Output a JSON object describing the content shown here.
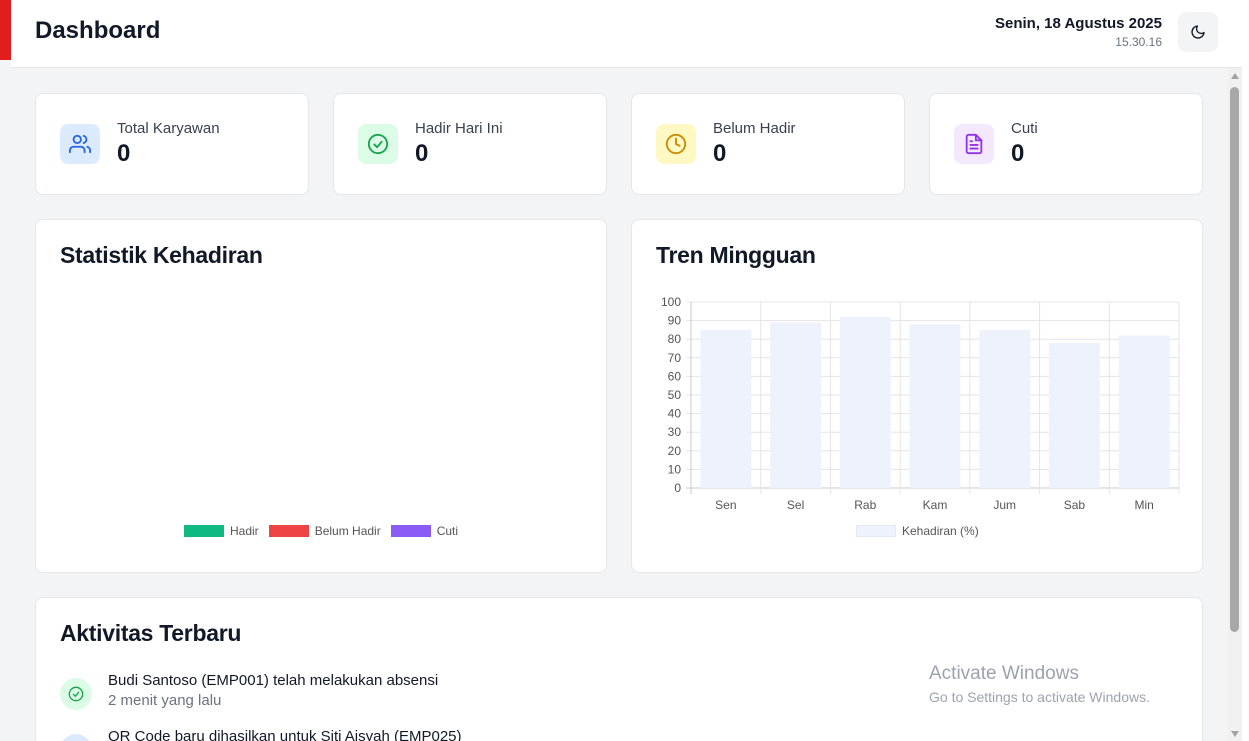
{
  "header": {
    "title": "Dashboard",
    "date": "Senin, 18 Agustus 2025",
    "time": "15.30.16",
    "theme_toggle_icon": "moon-icon"
  },
  "stats": [
    {
      "label": "Total Karyawan",
      "value": "0",
      "icon": "users-icon",
      "color": "#2563eb",
      "bg": "#dbeafe"
    },
    {
      "label": "Hadir Hari Ini",
      "value": "0",
      "icon": "check-circle-icon",
      "color": "#16a34a",
      "bg": "#dcfce7"
    },
    {
      "label": "Belum Hadir",
      "value": "0",
      "icon": "clock-icon",
      "color": "#ca8a04",
      "bg": "#fef9c3"
    },
    {
      "label": "Cuti",
      "value": "0",
      "icon": "document-icon",
      "color": "#9333ea",
      "bg": "#f3e8ff"
    }
  ],
  "attendance_panel": {
    "title": "Statistik Kehadiran",
    "legend": [
      {
        "label": "Hadir",
        "color": "#10b981"
      },
      {
        "label": "Belum Hadir",
        "color": "#ef4444"
      },
      {
        "label": "Cuti",
        "color": "#8b5cf6"
      }
    ]
  },
  "weekly_panel": {
    "title": "Tren Mingguan"
  },
  "chart_data": {
    "type": "bar",
    "title": "Tren Mingguan",
    "categories": [
      "Sen",
      "Sel",
      "Rab",
      "Kam",
      "Jum",
      "Sab",
      "Min"
    ],
    "series": [
      {
        "name": "Kehadiran (%)",
        "values": [
          85,
          89,
          92,
          88,
          85,
          78,
          82
        ],
        "color": "#eef2fd"
      }
    ],
    "y_ticks": [
      0,
      10,
      20,
      30,
      40,
      50,
      60,
      70,
      80,
      90,
      100
    ],
    "ylim": [
      0,
      100
    ],
    "grid": true,
    "legend_position": "bottom"
  },
  "activity": {
    "title": "Aktivitas Terbaru",
    "items": [
      {
        "title": "Budi Santoso (EMP001) telah melakukan absensi",
        "time": "2 menit yang lalu",
        "icon": "check-circle-icon",
        "color": "#16a34a",
        "bg": "#dcfce7"
      },
      {
        "title": "QR Code baru dihasilkan untuk Siti Aisyah (EMP025)",
        "time": "",
        "icon": "qr-code-icon",
        "color": "#2563eb",
        "bg": "#dbeafe"
      }
    ]
  },
  "watermark": {
    "title": "Activate Windows",
    "subtitle": "Go to Settings to activate Windows."
  }
}
